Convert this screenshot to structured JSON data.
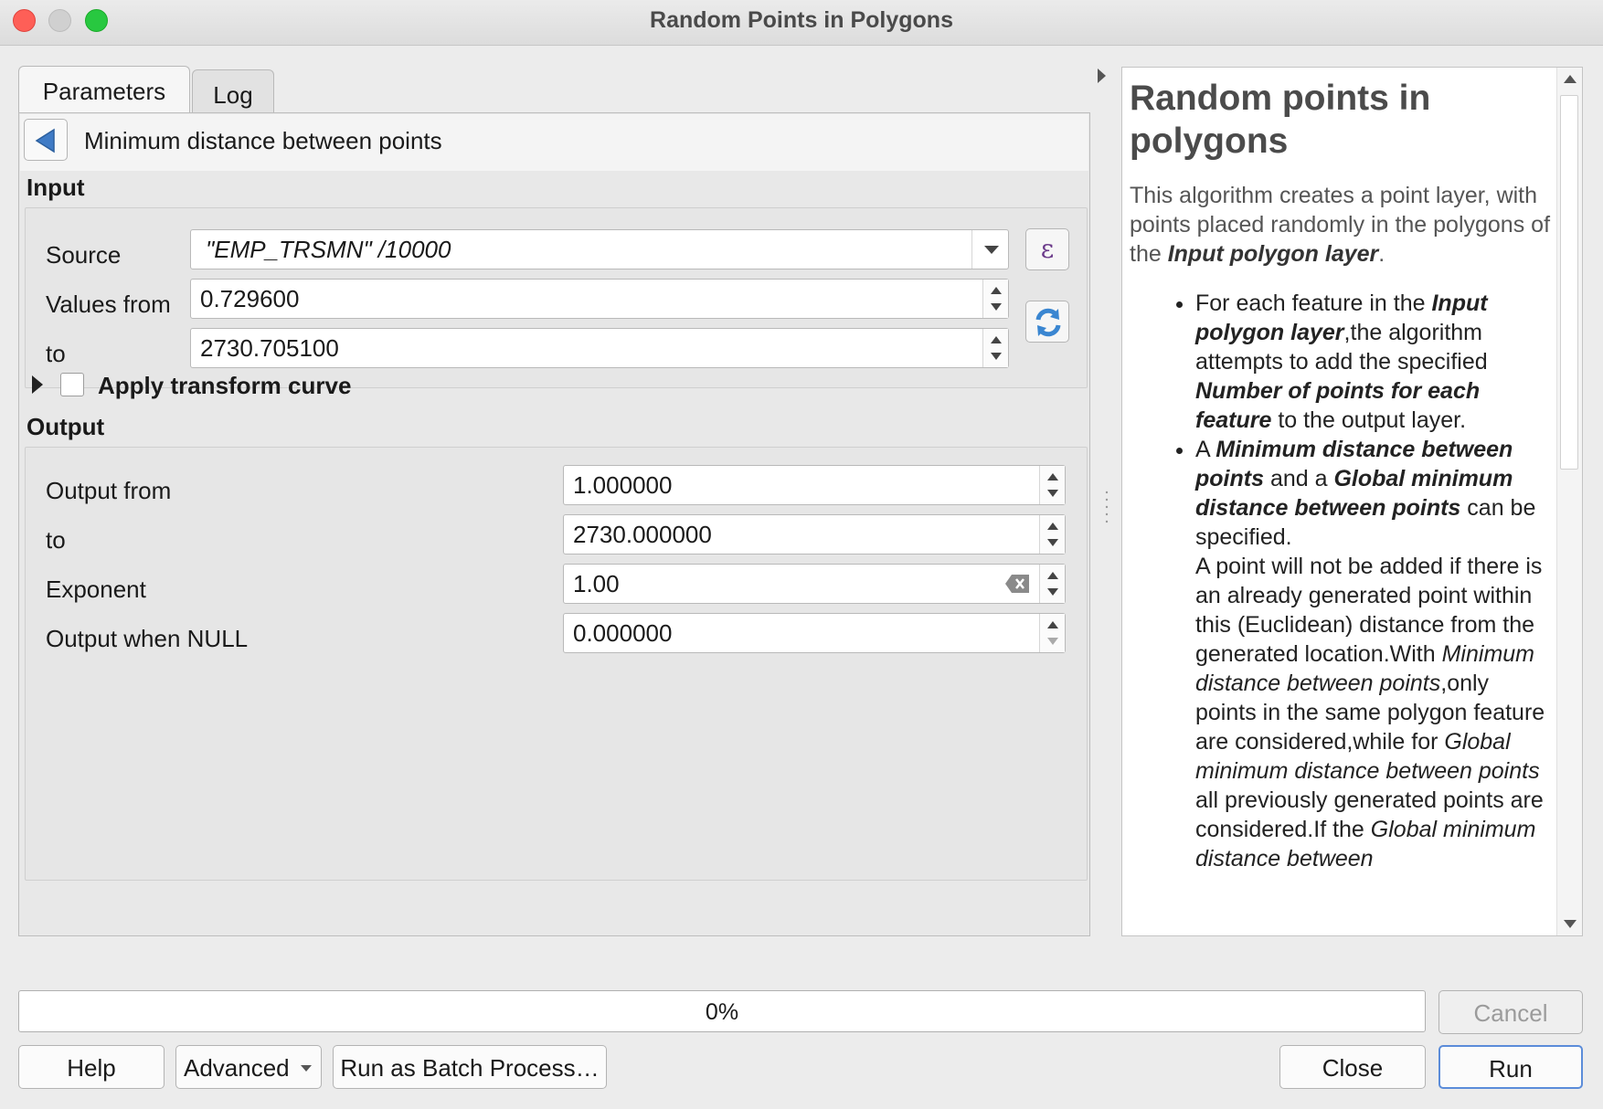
{
  "window": {
    "title": "Random Points in Polygons"
  },
  "tabs": [
    {
      "label": "Parameters",
      "active": true
    },
    {
      "label": "Log",
      "active": false
    }
  ],
  "breadcrumb": {
    "text": "Minimum distance between points"
  },
  "input_section": {
    "heading": "Input",
    "source_label": "Source",
    "source_value": "\"EMP_TRSMN\" /10000",
    "values_from_label": "Values from",
    "values_from_value": "0.729600",
    "to_label": "to",
    "to_value": "2730.705100",
    "expression_icon": "epsilon-icon",
    "refresh_icon": "refresh-icon"
  },
  "transform": {
    "label": "Apply transform curve",
    "checked": false
  },
  "output_section": {
    "heading": "Output",
    "output_from_label": "Output from",
    "output_from_value": "1.000000",
    "to_label": "to",
    "to_value": "2730.000000",
    "exponent_label": "Exponent",
    "exponent_value": "1.00",
    "null_label": "Output when NULL",
    "null_value": "0.000000"
  },
  "help": {
    "title": "Random points in polygons",
    "intro_pre": "This algorithm creates a point layer, with points placed randomly in the polygons of the ",
    "intro_bold": "Input polygon layer",
    "intro_post": ".",
    "bullet1": {
      "t1": "For each feature in the ",
      "b1": "Input polygon layer",
      "t2": ",the algorithm attempts to add the specified ",
      "b2": "Number of points for each feature",
      "t3": " to the output layer."
    },
    "bullet2": {
      "t1": "A ",
      "b1": "Minimum distance between points",
      "t2": " and a ",
      "b2": "Global minimum distance between points",
      "t3": " can be specified.",
      "t4": "A point will not be added if there is an already generated point within this (Euclidean) distance from the generated location.With ",
      "i1": "Minimum distance between points",
      "t5": ",only points in the same polygon feature are considered,while for ",
      "i2": "Global minimum distance between points",
      "t6": " all previously generated points are considered.If the ",
      "i3": "Global minimum distance between"
    }
  },
  "progress": {
    "text": "0%",
    "value": 0
  },
  "buttons": {
    "cancel": "Cancel",
    "help": "Help",
    "advanced": "Advanced",
    "batch": "Run as Batch Process…",
    "close": "Close",
    "run": "Run"
  },
  "colors": {
    "default_button_border": "#5b8cd9",
    "epsilon": "#6b3a8a"
  }
}
